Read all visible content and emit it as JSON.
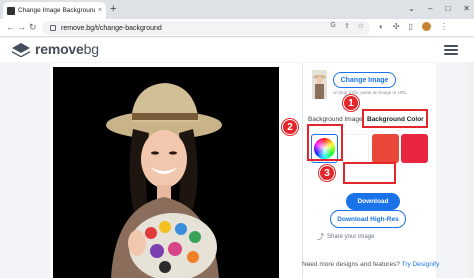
{
  "browser": {
    "tab_title": "Change Image Background -",
    "tab_close": "×",
    "new_tab": "+",
    "url": "remove.bg/t/change-background",
    "window_controls": [
      "⌄",
      "–",
      "□",
      "✕"
    ],
    "back": "←",
    "forward": "→",
    "reload": "↻"
  },
  "site": {
    "logo_word1": "remove",
    "logo_word2": "bg"
  },
  "panel": {
    "change_image_label": "Change Image",
    "paste_hint": "or drop a file, paste an image or URL",
    "tab_background_image": "Background Image",
    "tab_background_color": "Background Color",
    "swatch_colors": [
      "#ffffff",
      "#e8473a",
      "#e8263f"
    ],
    "download_label": "Download",
    "download_hr_label": "Download High-Res",
    "share_label": "Share your image",
    "more_designs_text": "Need more designs and features?",
    "more_designs_link": "Try Designify"
  },
  "annotations": {
    "marker1": "1",
    "marker2": "2",
    "marker3": "3",
    "color": "#e3262b"
  },
  "accent_color": "#1a73e8"
}
